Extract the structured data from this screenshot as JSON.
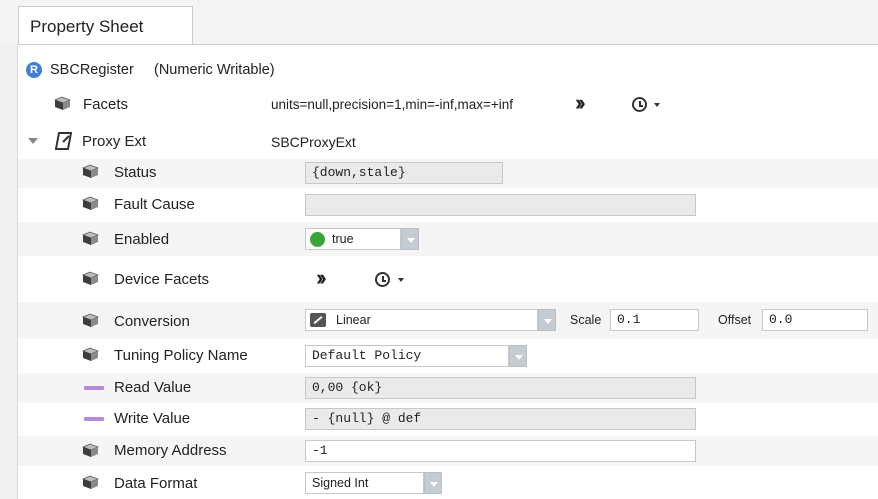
{
  "tab": {
    "label": "Property Sheet"
  },
  "root": {
    "badge": "R",
    "name": "SBCRegister",
    "type": "(Numeric Writable)"
  },
  "facets": {
    "label": "Facets",
    "value": "units=null,precision=1,min=-inf,max=+inf"
  },
  "proxy_ext": {
    "label": "Proxy Ext",
    "value": "SBCProxyExt"
  },
  "status": {
    "label": "Status",
    "value": "{down,stale}"
  },
  "fault_cause": {
    "label": "Fault Cause",
    "value": ""
  },
  "enabled": {
    "label": "Enabled",
    "value": "true",
    "color": "#3aa63a"
  },
  "device_facets": {
    "label": "Device Facets"
  },
  "conversion": {
    "label": "Conversion",
    "value": "Linear",
    "scale_label": "Scale",
    "scale_value": "0.1",
    "offset_label": "Offset",
    "offset_value": "0.0"
  },
  "tuning_policy": {
    "label": "Tuning Policy Name",
    "value": "Default Policy"
  },
  "read_value": {
    "label": "Read Value",
    "value": "0,00 {ok}"
  },
  "write_value": {
    "label": "Write Value",
    "value": "- {null} @ def"
  },
  "memory_address": {
    "label": "Memory Address",
    "value": "-1"
  },
  "data_format": {
    "label": "Data Format",
    "value": "Signed Int"
  },
  "icons": {
    "more": "chevron-double-right-icon",
    "history": "clock-icon",
    "property": "cube-icon",
    "proxy": "proxy-ext-icon",
    "expand": "caret-down-icon"
  }
}
